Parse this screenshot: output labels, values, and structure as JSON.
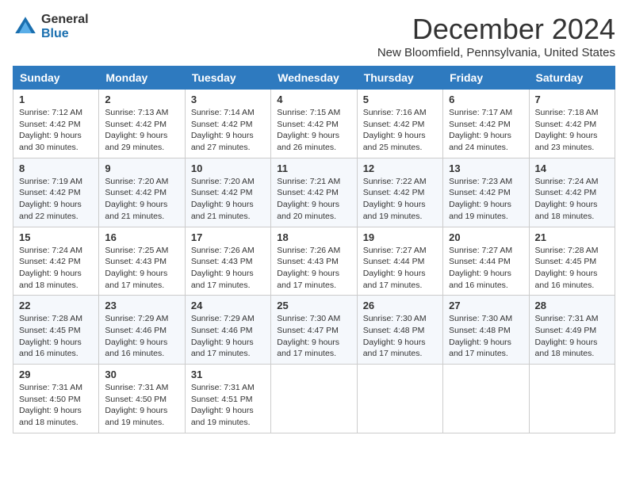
{
  "logo": {
    "general": "General",
    "blue": "Blue"
  },
  "title": {
    "month": "December 2024",
    "location": "New Bloomfield, Pennsylvania, United States"
  },
  "weekdays": [
    "Sunday",
    "Monday",
    "Tuesday",
    "Wednesday",
    "Thursday",
    "Friday",
    "Saturday"
  ],
  "weeks": [
    [
      {
        "day": "1",
        "sunrise": "7:12 AM",
        "sunset": "4:42 PM",
        "daylight": "9 hours and 30 minutes."
      },
      {
        "day": "2",
        "sunrise": "7:13 AM",
        "sunset": "4:42 PM",
        "daylight": "9 hours and 29 minutes."
      },
      {
        "day": "3",
        "sunrise": "7:14 AM",
        "sunset": "4:42 PM",
        "daylight": "9 hours and 27 minutes."
      },
      {
        "day": "4",
        "sunrise": "7:15 AM",
        "sunset": "4:42 PM",
        "daylight": "9 hours and 26 minutes."
      },
      {
        "day": "5",
        "sunrise": "7:16 AM",
        "sunset": "4:42 PM",
        "daylight": "9 hours and 25 minutes."
      },
      {
        "day": "6",
        "sunrise": "7:17 AM",
        "sunset": "4:42 PM",
        "daylight": "9 hours and 24 minutes."
      },
      {
        "day": "7",
        "sunrise": "7:18 AM",
        "sunset": "4:42 PM",
        "daylight": "9 hours and 23 minutes."
      }
    ],
    [
      {
        "day": "8",
        "sunrise": "7:19 AM",
        "sunset": "4:42 PM",
        "daylight": "9 hours and 22 minutes."
      },
      {
        "day": "9",
        "sunrise": "7:20 AM",
        "sunset": "4:42 PM",
        "daylight": "9 hours and 21 minutes."
      },
      {
        "day": "10",
        "sunrise": "7:20 AM",
        "sunset": "4:42 PM",
        "daylight": "9 hours and 21 minutes."
      },
      {
        "day": "11",
        "sunrise": "7:21 AM",
        "sunset": "4:42 PM",
        "daylight": "9 hours and 20 minutes."
      },
      {
        "day": "12",
        "sunrise": "7:22 AM",
        "sunset": "4:42 PM",
        "daylight": "9 hours and 19 minutes."
      },
      {
        "day": "13",
        "sunrise": "7:23 AM",
        "sunset": "4:42 PM",
        "daylight": "9 hours and 19 minutes."
      },
      {
        "day": "14",
        "sunrise": "7:24 AM",
        "sunset": "4:42 PM",
        "daylight": "9 hours and 18 minutes."
      }
    ],
    [
      {
        "day": "15",
        "sunrise": "7:24 AM",
        "sunset": "4:42 PM",
        "daylight": "9 hours and 18 minutes."
      },
      {
        "day": "16",
        "sunrise": "7:25 AM",
        "sunset": "4:43 PM",
        "daylight": "9 hours and 17 minutes."
      },
      {
        "day": "17",
        "sunrise": "7:26 AM",
        "sunset": "4:43 PM",
        "daylight": "9 hours and 17 minutes."
      },
      {
        "day": "18",
        "sunrise": "7:26 AM",
        "sunset": "4:43 PM",
        "daylight": "9 hours and 17 minutes."
      },
      {
        "day": "19",
        "sunrise": "7:27 AM",
        "sunset": "4:44 PM",
        "daylight": "9 hours and 17 minutes."
      },
      {
        "day": "20",
        "sunrise": "7:27 AM",
        "sunset": "4:44 PM",
        "daylight": "9 hours and 16 minutes."
      },
      {
        "day": "21",
        "sunrise": "7:28 AM",
        "sunset": "4:45 PM",
        "daylight": "9 hours and 16 minutes."
      }
    ],
    [
      {
        "day": "22",
        "sunrise": "7:28 AM",
        "sunset": "4:45 PM",
        "daylight": "9 hours and 16 minutes."
      },
      {
        "day": "23",
        "sunrise": "7:29 AM",
        "sunset": "4:46 PM",
        "daylight": "9 hours and 16 minutes."
      },
      {
        "day": "24",
        "sunrise": "7:29 AM",
        "sunset": "4:46 PM",
        "daylight": "9 hours and 17 minutes."
      },
      {
        "day": "25",
        "sunrise": "7:30 AM",
        "sunset": "4:47 PM",
        "daylight": "9 hours and 17 minutes."
      },
      {
        "day": "26",
        "sunrise": "7:30 AM",
        "sunset": "4:48 PM",
        "daylight": "9 hours and 17 minutes."
      },
      {
        "day": "27",
        "sunrise": "7:30 AM",
        "sunset": "4:48 PM",
        "daylight": "9 hours and 17 minutes."
      },
      {
        "day": "28",
        "sunrise": "7:31 AM",
        "sunset": "4:49 PM",
        "daylight": "9 hours and 18 minutes."
      }
    ],
    [
      {
        "day": "29",
        "sunrise": "7:31 AM",
        "sunset": "4:50 PM",
        "daylight": "9 hours and 18 minutes."
      },
      {
        "day": "30",
        "sunrise": "7:31 AM",
        "sunset": "4:50 PM",
        "daylight": "9 hours and 19 minutes."
      },
      {
        "day": "31",
        "sunrise": "7:31 AM",
        "sunset": "4:51 PM",
        "daylight": "9 hours and 19 minutes."
      },
      null,
      null,
      null,
      null
    ]
  ],
  "labels": {
    "sunrise": "Sunrise:",
    "sunset": "Sunset:",
    "daylight": "Daylight:"
  }
}
